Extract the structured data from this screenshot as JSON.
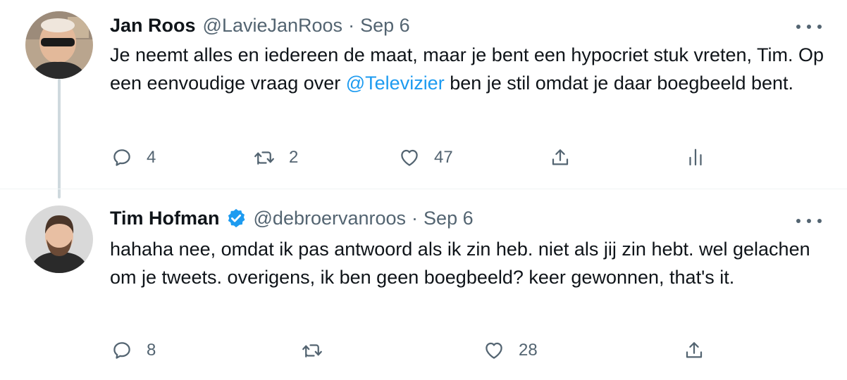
{
  "tweets": [
    {
      "author_name": "Jan Roos",
      "handle": "@LavieJanRoos",
      "separator": "·",
      "date": "Sep 6",
      "verified": false,
      "text_before": "Je neemt alles en iedereen de maat, maar je bent een hypocriet stuk vreten, Tim. Op een eenvoudige vraag over ",
      "mention": "@Televizier",
      "text_after": " ben je stil omdat je daar boegbeeld bent.",
      "replies": "4",
      "retweets": "2",
      "likes": "47",
      "icons": [
        "reply-icon",
        "retweet-icon",
        "like-icon",
        "share-icon",
        "analytics-icon",
        "more-icon"
      ]
    },
    {
      "author_name": "Tim Hofman",
      "handle": "@debroervanroos",
      "separator": "·",
      "date": "Sep 6",
      "verified": true,
      "text": "hahaha nee, omdat ik pas antwoord als ik zin heb. niet als jij zin hebt. wel gelachen om je tweets. overigens, ik ben geen boegbeeld? keer gewonnen, that's it.",
      "replies": "8",
      "likes": "28",
      "icons": [
        "reply-icon",
        "retweet-icon",
        "like-icon",
        "share-icon",
        "more-icon"
      ]
    }
  ],
  "colors": {
    "text": "#0f1419",
    "secondary": "#536471",
    "link": "#1d9bf0",
    "thread_line": "#cfd9de"
  }
}
